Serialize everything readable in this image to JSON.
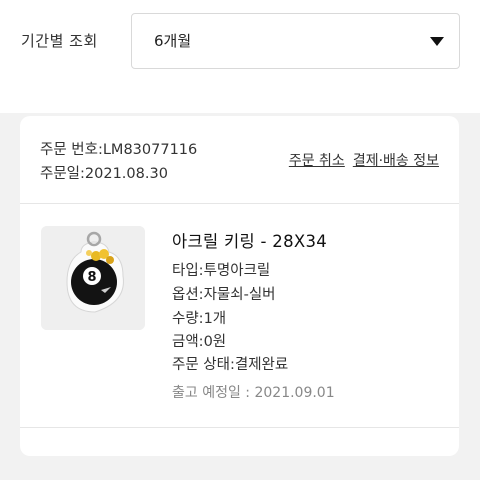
{
  "filter": {
    "label": "기간별 조회",
    "selected": "6개월"
  },
  "order": {
    "number_text": "주문 번호:LM83077116",
    "date_text": "주문일:2021.08.30",
    "cancel_label": "주문 취소",
    "payment_shipping_label": "결제·배송 정보",
    "product": {
      "name": "아크릴 키링 - 28X34",
      "image_text": "8",
      "specs": [
        "타입:투명아크릴",
        "옵션:자물쇠-실버",
        "수량:1개",
        "금액:0원",
        "주문 상태:결제완료"
      ],
      "ship_date_text": "출고 예정일 : 2021.09.01"
    }
  }
}
